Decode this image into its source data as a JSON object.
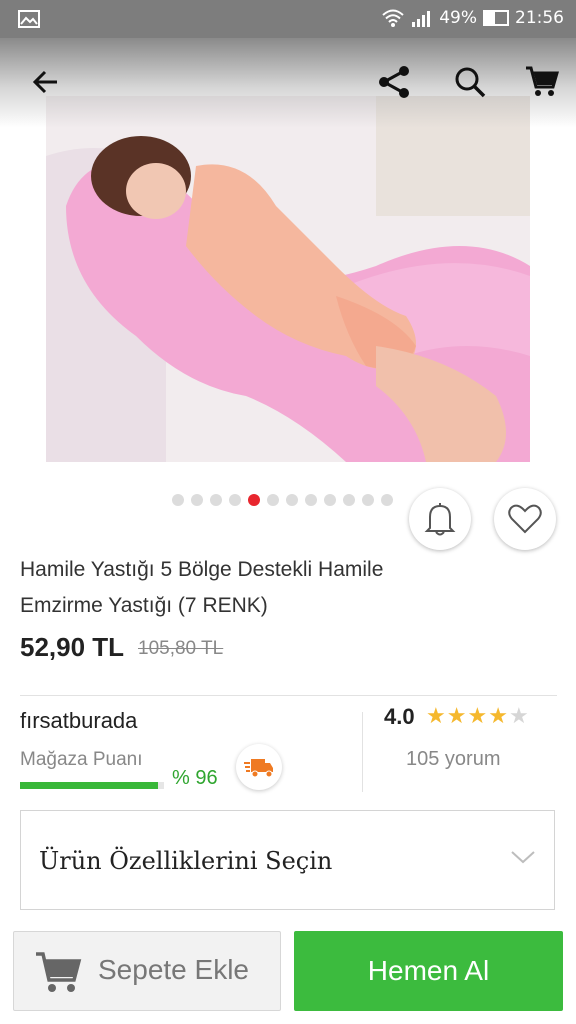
{
  "status_bar": {
    "battery": "49%",
    "time": "21:56",
    "icons": [
      "image-icon",
      "wifi-icon",
      "signal-icon",
      "battery-icon"
    ]
  },
  "appbar": {
    "icons": [
      "back-arrow-icon",
      "share-icon",
      "search-icon",
      "cart-icon"
    ]
  },
  "gallery": {
    "image_count": 12,
    "active_index": 4,
    "notify_icon": "bell-icon",
    "favorite_icon": "heart-icon"
  },
  "product": {
    "title": "Hamile Yastığı 5 Bölge Destekli Hamile Emzirme Yastığı (7 RENK)",
    "price": "52,90 TL",
    "old_price": "105,80 TL"
  },
  "seller": {
    "name": "fırsatburada",
    "score_label": "Mağaza Puanı",
    "score": "% 96",
    "score_fraction": 0.96,
    "shipping_icon": "fast-shipping-truck-icon"
  },
  "rating": {
    "value": "4.0",
    "stars_filled": 4,
    "stars_total": 5,
    "reviews": "105 yorum"
  },
  "options": {
    "label": "Ürün Özelliklerini Seçin"
  },
  "actions": {
    "add_to_cart": "Sepete Ekle",
    "buy_now": "Hemen Al"
  },
  "colors": {
    "accent_green": "#3cbb3e",
    "active_dot": "#e8262e",
    "star": "#f5b82e"
  }
}
